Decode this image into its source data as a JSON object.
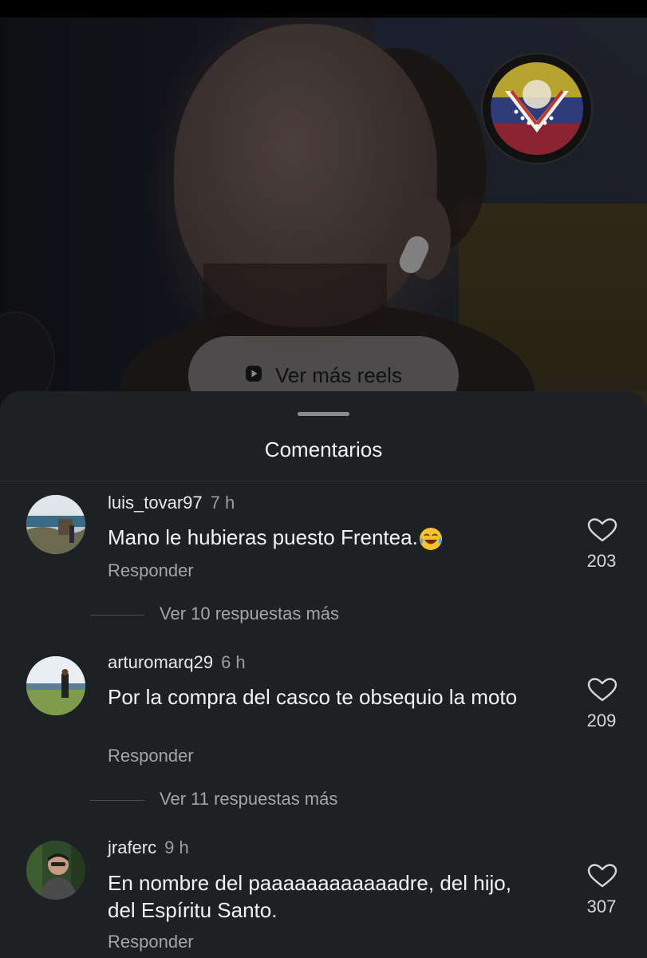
{
  "video": {
    "more_reels_label": "Ver más reels",
    "play_icon": "play-square-icon"
  },
  "sheet": {
    "title": "Comentarios"
  },
  "comments": [
    {
      "username": "luis_tovar97",
      "time": "7 h",
      "text": "Mano le hubieras puesto Frentea.",
      "emoji": "laughing-tears-emoji",
      "reply_label": "Responder",
      "likes": "203",
      "more_replies": "Ver 10 respuestas más"
    },
    {
      "username": "arturomarq29",
      "time": "6 h",
      "text": "Por la compra del casco te obsequio la moto",
      "reply_label": "Responder",
      "likes": "209",
      "more_replies": "Ver 11 respuestas más"
    },
    {
      "username": "jraferc",
      "time": "9 h",
      "text": "En nombre del paaaaaaaaaaaadre, del hijo, del Espíritu Santo.",
      "reply_label": "Responder",
      "likes": "307"
    }
  ],
  "colors": {
    "sheet_bg": "#1e2123",
    "text_primary": "#f2f2f2",
    "text_secondary": "#a2a5a9"
  }
}
